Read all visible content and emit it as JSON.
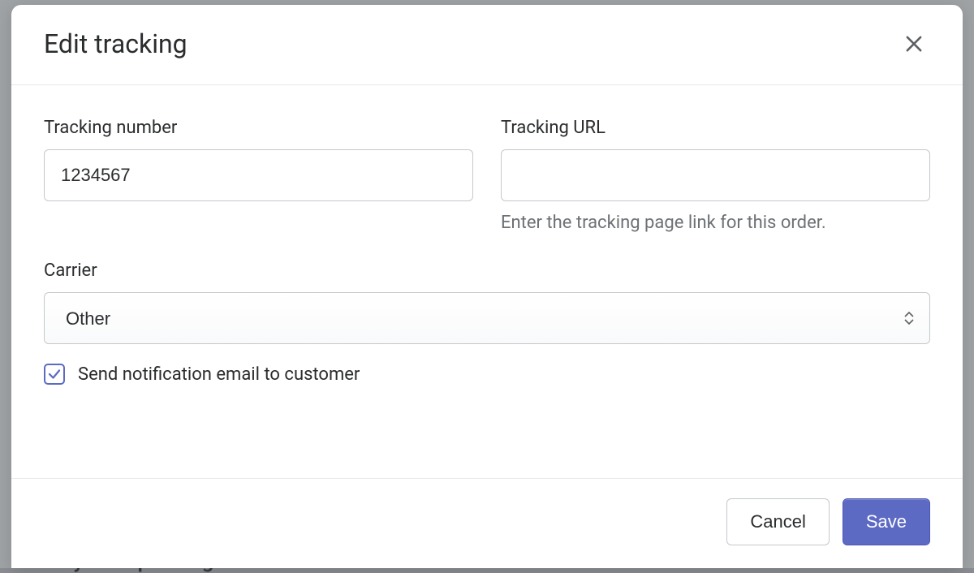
{
  "modal": {
    "title": "Edit tracking",
    "fields": {
      "tracking_number": {
        "label": "Tracking number",
        "value": "1234567"
      },
      "tracking_url": {
        "label": "Tracking URL",
        "value": "",
        "help": "Enter the tracking page link for this order."
      },
      "carrier": {
        "label": "Carrier",
        "selected": "Other"
      },
      "notify": {
        "label": "Send notification email to customer",
        "checked": true
      }
    },
    "buttons": {
      "cancel": "Cancel",
      "save": "Save"
    }
  },
  "background": {
    "status_text": "Payment pending"
  }
}
